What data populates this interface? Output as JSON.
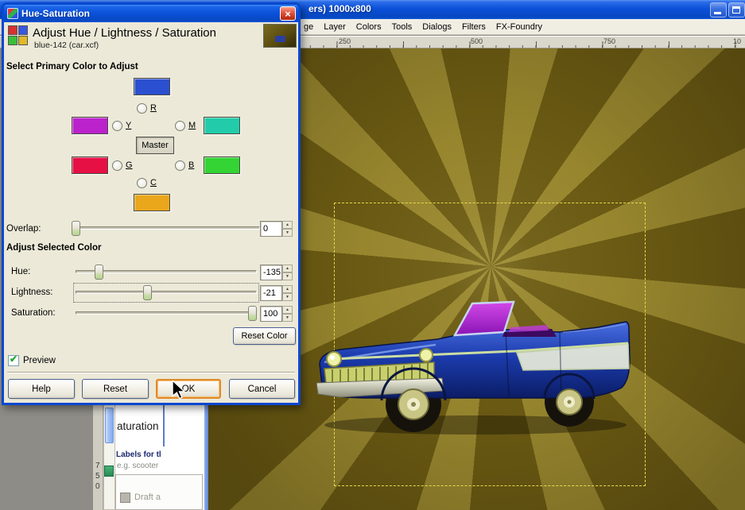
{
  "window": {
    "title_fragment": "ers) 1000x800",
    "menu_items": [
      "ge",
      "Layer",
      "Colors",
      "Tools",
      "Dialogs",
      "Filters",
      "FX-Foundry"
    ],
    "ruler_marks": [
      "250",
      "500",
      "750",
      "10"
    ]
  },
  "dialog": {
    "title": "Hue-Saturation",
    "header_title": "Adjust Hue / Lightness / Saturation",
    "header_subtitle": "blue-142 (car.xcf)",
    "select_primary_label": "Select Primary Color to Adjust",
    "master_label": "Master",
    "channel_labels": [
      "R",
      "Y",
      "M",
      "G",
      "B",
      "C"
    ],
    "overlap_label": "Overlap:",
    "overlap_value": "0",
    "adjust_label": "Adjust Selected Color",
    "hue_label": "Hue:",
    "hue_value": "-135",
    "lightness_label": "Lightness:",
    "lightness_value": "-21",
    "saturation_label": "Saturation:",
    "saturation_value": "100",
    "reset_color_label": "Reset Color",
    "preview_label": "Preview",
    "help_label": "Help",
    "reset_label": "Reset",
    "ok_label": "OK",
    "cancel_label": "Cancel"
  },
  "background_panel": {
    "heading_fragment": "aturation",
    "bold_label": "Labels for tl",
    "sub_label": "e.g. scooter",
    "draft_label": "Draft a",
    "vruler_digits": [
      "7",
      "5",
      "0"
    ]
  },
  "icons": {
    "close": "×",
    "check": "✔",
    "up": "▲",
    "down": "▼"
  },
  "colors": {
    "swatch_blue": "#2a4fd0",
    "swatch_magenta": "#bb22cc",
    "swatch_teal": "#22ccaa",
    "swatch_red": "#e61045",
    "swatch_green": "#33d433",
    "swatch_yellow": "#eaa71c",
    "canvas_dark": "#6a5a13",
    "canvas_light": "#97862e",
    "selection_dash": "#e8d84e",
    "titlebar_blue": "#0a51d8",
    "ok_focus_border": "#e08a2a",
    "check_green": "#21a828"
  }
}
